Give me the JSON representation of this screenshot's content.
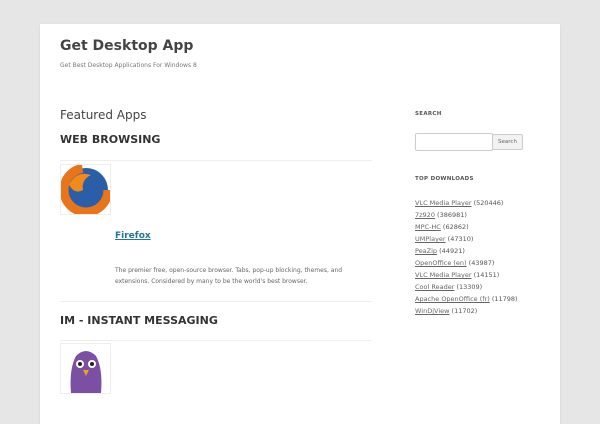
{
  "site": {
    "title": "Get Desktop App",
    "tagline": "Get Best Desktop Applications For Windows 8"
  },
  "main": {
    "heading": "Featured Apps",
    "categories": [
      {
        "name": "WEB BROWSING",
        "app": "Firefox",
        "description": "The premier free, open-source browser. Tabs, pop-up blocking, themes, and extensions. Considered by many to be the world's best browser."
      },
      {
        "name": "IM - INSTANT MESSAGING"
      }
    ]
  },
  "sidebar": {
    "search_title": "SEARCH",
    "search_placeholder": "",
    "search_button": "Search",
    "downloads_title": "TOP DOWNLOADS",
    "downloads": [
      {
        "name": "VLC Media Player",
        "count": "(520446)"
      },
      {
        "name": "7z920",
        "count": "(386981)"
      },
      {
        "name": "MPC-HC",
        "count": "(62862)"
      },
      {
        "name": "UMPlayer",
        "count": "(47310)"
      },
      {
        "name": "PeaZip",
        "count": "(44921)"
      },
      {
        "name": "OpenOffice (en)",
        "count": "(43987)"
      },
      {
        "name": "VLC Media Player",
        "count": "(14151)"
      },
      {
        "name": "Cool Reader",
        "count": "(13309)"
      },
      {
        "name": "Apache OpenOffice (fr)",
        "count": "(11798)"
      },
      {
        "name": "WinDjView",
        "count": "(11702)"
      }
    ]
  }
}
